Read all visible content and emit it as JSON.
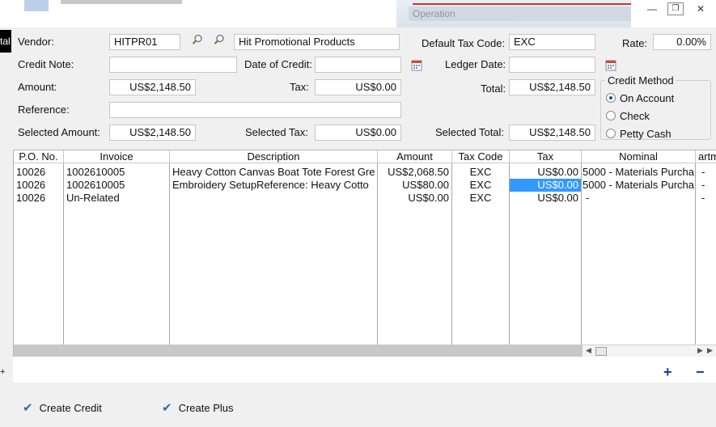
{
  "window": {
    "background_title": "Operation",
    "side_tab": "tal",
    "buttons": {
      "minimize": "—",
      "restore": "❐",
      "close": "✕"
    }
  },
  "form": {
    "vendor_label": "Vendor:",
    "vendor_code": "HITPR01",
    "vendor_name": "Hit Promotional Products",
    "default_tax_label": "Default Tax Code:",
    "default_tax_code": "EXC",
    "rate_label": "Rate:",
    "rate_value": "0.00%",
    "credit_note_label": "Credit Note:",
    "credit_note_value": "",
    "date_of_credit_label": "Date of Credit:",
    "date_of_credit_value": "",
    "ledger_date_label": "Ledger Date:",
    "ledger_date_value": "",
    "amount_label": "Amount:",
    "amount_value": "US$2,148.50",
    "tax_label": "Tax:",
    "tax_value": "US$0.00",
    "total_label": "Total:",
    "total_value": "US$2,148.50",
    "reference_label": "Reference:",
    "reference_value": "",
    "selected_amount_label": "Selected Amount:",
    "selected_amount_value": "US$2,148.50",
    "selected_tax_label": "Selected Tax:",
    "selected_tax_value": "US$0.00",
    "selected_total_label": "Selected Total:",
    "selected_total_value": "US$2,148.50"
  },
  "credit_method": {
    "title": "Credit Method",
    "options": [
      {
        "label": "On Account",
        "selected": true
      },
      {
        "label": "Check",
        "selected": false
      },
      {
        "label": "Petty Cash",
        "selected": false
      }
    ]
  },
  "grid": {
    "columns": [
      "P.O. No.",
      "Invoice",
      "Description",
      "Amount",
      "Tax Code",
      "Tax",
      "Nominal",
      "artm"
    ],
    "rows": [
      {
        "po": "10026",
        "invoice": "1002610005",
        "description": "Heavy Cotton Canvas Boat Tote Forest Gre",
        "amount": "US$2,068.50",
        "tax_code": "EXC",
        "tax": "US$0.00",
        "nominal": "5000 - Materials Purcha",
        "dept": "-"
      },
      {
        "po": "10026",
        "invoice": "1002610005",
        "description": "Embroidery SetupReference: Heavy Cotto",
        "amount": "US$80.00",
        "tax_code": "EXC",
        "tax": "US$0.00",
        "nominal": "5000 - Materials Purcha",
        "dept": "-"
      },
      {
        "po": "10026",
        "invoice": "Un-Related",
        "description": "",
        "amount": "US$0.00",
        "tax_code": "EXC",
        "tax": "US$0.00",
        "nominal": "-",
        "dept": "-"
      }
    ]
  },
  "row_buttons": {
    "add": "+",
    "remove": "−"
  },
  "actions": {
    "create_credit": "Create Credit",
    "create_plus": "Create Plus",
    "check_glyph": "✔"
  },
  "colors": {
    "selection": "#3399ff",
    "accent": "#1c3f99"
  }
}
